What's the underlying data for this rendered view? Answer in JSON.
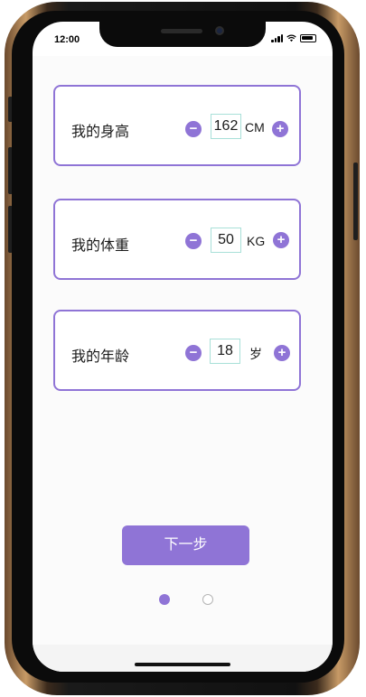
{
  "status_bar": {
    "time": "12:00"
  },
  "cards": [
    {
      "label": "我的身高",
      "value": "162",
      "unit": "CM",
      "minus": "−",
      "plus": "+"
    },
    {
      "label": "我的体重",
      "value": "50",
      "unit": "KG",
      "minus": "−",
      "plus": "+"
    },
    {
      "label": "我的年龄",
      "value": "18",
      "unit": "岁",
      "minus": "−",
      "plus": "+"
    }
  ],
  "next_button": {
    "label": "下一步"
  },
  "pager": {
    "total": 2,
    "active": 1
  },
  "colors": {
    "accent": "#8f74d6",
    "input_border": "#a8e0d8"
  },
  "icons": {
    "minus": "minus-icon",
    "plus": "plus-icon",
    "wifi": "wifi-icon",
    "signal": "signal-icon",
    "battery": "battery-icon"
  }
}
